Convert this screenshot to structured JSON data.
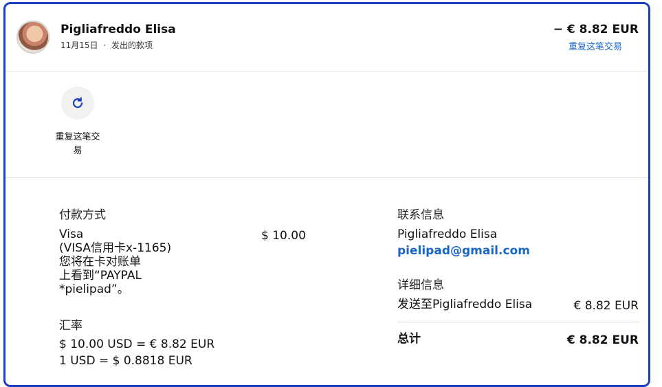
{
  "header": {
    "name": "Pigliafreddo Elisa",
    "date": "11月15日",
    "separator": "·",
    "type": "发出的款项",
    "amount": "− € 8.82 EUR",
    "repeat_link": "重复这笔交易"
  },
  "action": {
    "label_line1": "重复这笔交",
    "label_line2": "易",
    "icon": "refresh-icon"
  },
  "payment": {
    "title": "付款方式",
    "method": "Visa",
    "card": "(VISA信用卡x-1165)",
    "note_line1": "您将在卡对账单",
    "note_line2": "上看到“PAYPAL",
    "note_line3": "*pielipad”。",
    "amount": "$ 10.00"
  },
  "exchange": {
    "title": "汇率",
    "line1": "$ 10.00 USD = € 8.82 EUR",
    "line2": "1 USD = $ 0.8818 EUR"
  },
  "contact": {
    "title": "联系信息",
    "name": "Pigliafreddo Elisa",
    "email": "pielipad@gmail.com"
  },
  "details": {
    "title": "详细信息",
    "send_to": "发送至Pigliafreddo Elisa",
    "send_amount": "€ 8.82 EUR",
    "total_label": "总计",
    "total_amount": "€ 8.82 EUR"
  },
  "colors": {
    "border": "#1a3fbf",
    "link": "#1a67c8"
  }
}
